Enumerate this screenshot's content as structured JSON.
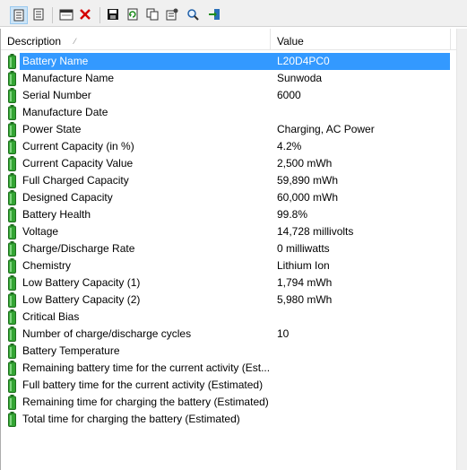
{
  "toolbar": {
    "buttons": [
      {
        "name": "properties-icon"
      },
      {
        "name": "html-report-icon"
      },
      {
        "name": "options-window-icon"
      },
      {
        "name": "delete-icon"
      },
      {
        "name": "save-icon"
      },
      {
        "name": "refresh-icon"
      },
      {
        "name": "copy-icon"
      },
      {
        "name": "settings-icon"
      },
      {
        "name": "find-icon"
      },
      {
        "name": "exit-icon"
      }
    ]
  },
  "list": {
    "columns": {
      "description": "Description",
      "value": "Value"
    },
    "rows": [
      {
        "label": "Battery Name",
        "value": "L20D4PC0",
        "selected": true
      },
      {
        "label": "Manufacture Name",
        "value": "Sunwoda"
      },
      {
        "label": "Serial Number",
        "value": "6000"
      },
      {
        "label": "Manufacture Date",
        "value": ""
      },
      {
        "label": "Power State",
        "value": "Charging, AC Power"
      },
      {
        "label": "Current Capacity (in %)",
        "value": "4.2%"
      },
      {
        "label": "Current Capacity Value",
        "value": "2,500 mWh"
      },
      {
        "label": "Full Charged Capacity",
        "value": "59,890 mWh"
      },
      {
        "label": "Designed Capacity",
        "value": "60,000 mWh"
      },
      {
        "label": "Battery Health",
        "value": "99.8%"
      },
      {
        "label": "Voltage",
        "value": "14,728 millivolts"
      },
      {
        "label": "Charge/Discharge Rate",
        "value": "0 milliwatts"
      },
      {
        "label": "Chemistry",
        "value": "Lithium Ion"
      },
      {
        "label": "Low Battery Capacity (1)",
        "value": "1,794 mWh"
      },
      {
        "label": "Low Battery Capacity (2)",
        "value": "5,980 mWh"
      },
      {
        "label": "Critical Bias",
        "value": ""
      },
      {
        "label": "Number of charge/discharge cycles",
        "value": "10"
      },
      {
        "label": "Battery Temperature",
        "value": ""
      },
      {
        "label": "Remaining battery time for the current activity (Est...",
        "value": ""
      },
      {
        "label": "Full battery time for the current activity (Estimated)",
        "value": ""
      },
      {
        "label": "Remaining time for charging the battery (Estimated)",
        "value": ""
      },
      {
        "label": "Total  time for charging the battery (Estimated)",
        "value": ""
      }
    ]
  },
  "colors": {
    "selection": "#3399ff",
    "battery_green": "#2e9e2e",
    "toolbar_bg": "#f0f0f0"
  }
}
